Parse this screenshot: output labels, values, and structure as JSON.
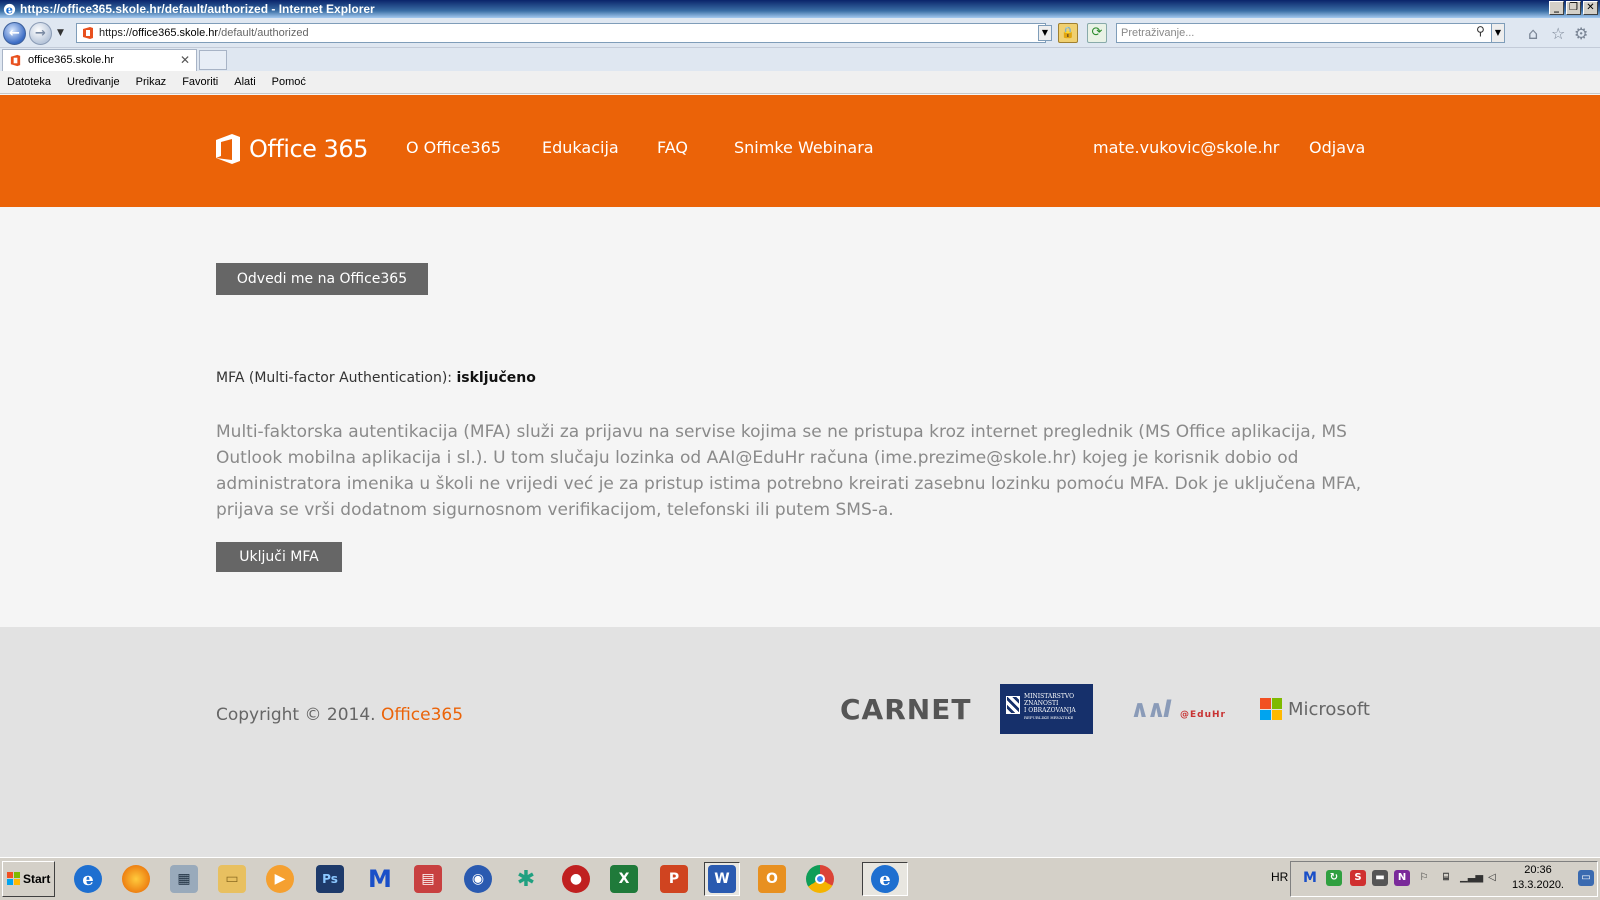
{
  "window": {
    "title": "https://office365.skole.hr/default/authorized - Internet Explorer",
    "url_prefix": "https://",
    "url_host": "office365.skole.hr",
    "url_path": "/default/authorized",
    "search_placeholder": "Pretraživanje...",
    "tab_title": "office365.skole.hr"
  },
  "menu": [
    "Datoteka",
    "Uređivanje",
    "Prikaz",
    "Favoriti",
    "Alati",
    "Pomoć"
  ],
  "header": {
    "brand": "Office 365",
    "nav": [
      "O Office365",
      "Edukacija",
      "FAQ",
      "Snimke Webinara"
    ],
    "user": "mate.vukovic@skole.hr",
    "logout": "Odjava",
    "color": "#eb6308"
  },
  "main": {
    "goto_button": "Odvedi me na Office365",
    "mfa_label": "MFA (Multi-factor Authentication):",
    "mfa_value": "isključeno",
    "mfa_description": "Multi-faktorska autentikacija (MFA) služi za prijavu na servise kojima se ne pristupa kroz internet preglednik (MS Office aplikacija, MS Outlook mobilna aplikacija i sl.). U tom slučaju lozinka od AAI@EduHr računa (ime.prezime@skole.hr) kojeg je korisnik dobio od administratora imenika u školi ne vrijedi već je za pristup istima potrebno kreirati zasebnu lozinku pomoću MFA. Dok je uključena MFA, prijava se vrši dodatnom sigurnosnom verifikacijom, telefonski ili putem SMS-a.",
    "mfa_button": "Uključi MFA"
  },
  "footer": {
    "copyright": "Copyright © 2014.",
    "copyright_link": "Office365",
    "carnet": "CARNET",
    "ministry": [
      "MINISTARSTVO",
      "ZNANOSTI",
      "I OBRAZOVANJA",
      "REPUBLIKE HRVATSKE"
    ],
    "eduhr": "@EduHr",
    "microsoft": "Microsoft"
  },
  "taskbar": {
    "start": "Start",
    "lang": "HR",
    "time": "20:36",
    "date": "13.3.2020."
  }
}
